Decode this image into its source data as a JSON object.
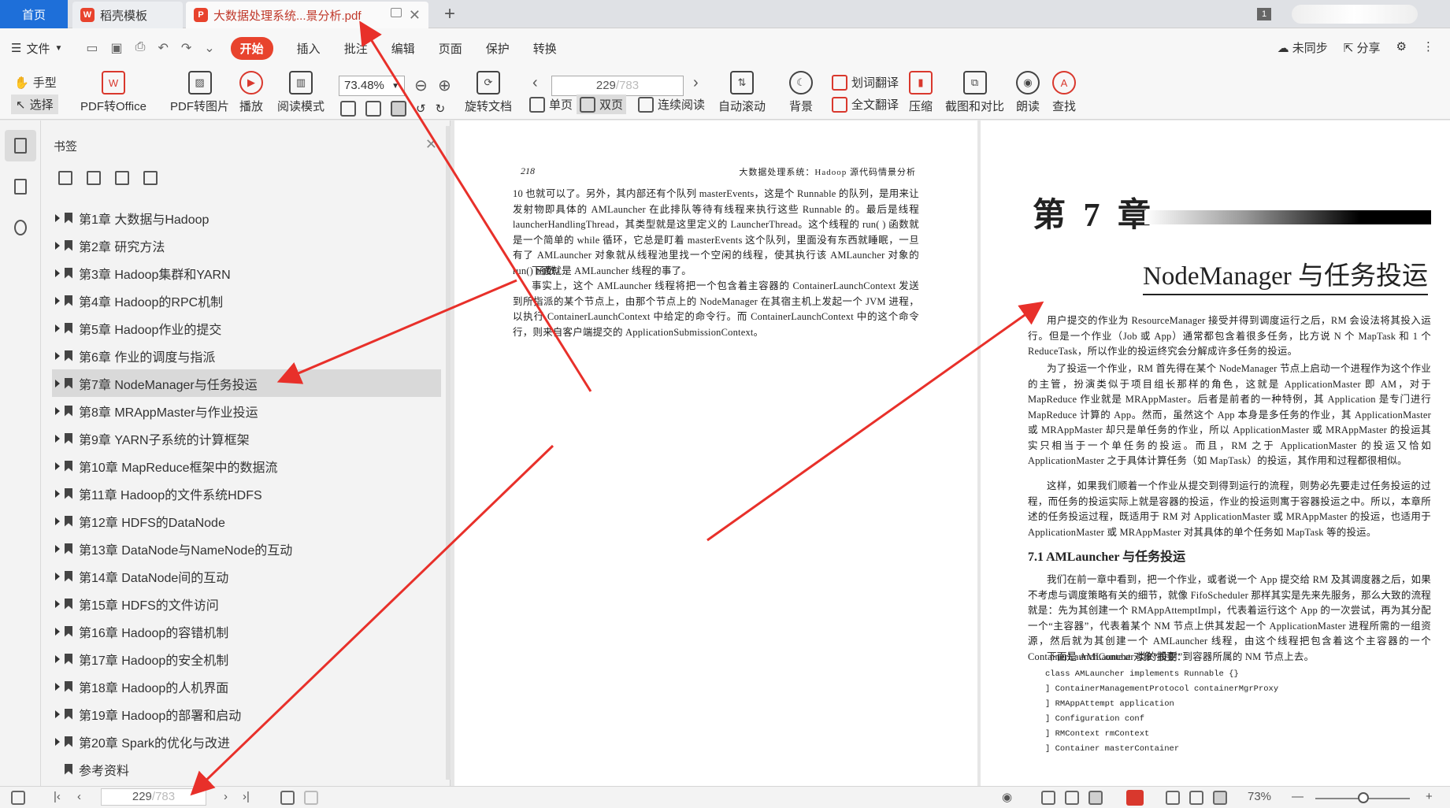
{
  "tabs": {
    "home": "首页",
    "template": "稻壳模板",
    "document": "大数据处理系统...景分析.pdf",
    "counter": "1"
  },
  "menu": {
    "file": "文件",
    "items": [
      "开始",
      "插入",
      "批注",
      "编辑",
      "页面",
      "保护",
      "转换"
    ],
    "sync": "未同步",
    "share": "分享"
  },
  "toolbar": {
    "hand": "手型",
    "select": "选择",
    "pdf_to_office": "PDF转Office",
    "pdf_to_image": "PDF转图片",
    "play": "播放",
    "read_mode": "阅读模式",
    "zoom": "73.48%",
    "rotate": "旋转文档",
    "page_current": "229",
    "page_total": "/783",
    "single": "单页",
    "double": "双页",
    "continuous": "连续阅读",
    "auto_scroll": "自动滚动",
    "background": "背景",
    "word_translate": "划词翻译",
    "full_translate": "全文翻译",
    "compress": "压缩",
    "screenshot": "截图和对比",
    "read_aloud": "朗读",
    "find": "查找"
  },
  "bookmarks": {
    "title": "书签",
    "items": [
      "第1章  大数据与Hadoop",
      "第2章  研究方法",
      "第3章  Hadoop集群和YARN",
      "第4章  Hadoop的RPC机制",
      "第5章  Hadoop作业的提交",
      "第6章  作业的调度与指派",
      "第7章  NodeManager与任务投运",
      "第8章  MRAppMaster与作业投运",
      "第9章  YARN子系统的计算框架",
      "第10章  MapReduce框架中的数据流",
      "第11章  Hadoop的文件系统HDFS",
      "第12章  HDFS的DataNode",
      "第13章  DataNode与NameNode的互动",
      "第14章  DataNode间的互动",
      "第15章  HDFS的文件访问",
      "第16章  Hadoop的容错机制",
      "第17章  Hadoop的安全机制",
      "第18章  Hadoop的人机界面",
      "第19章  Hadoop的部署和启动",
      "第20章  Spark的优化与改进",
      "参考资料"
    ]
  },
  "left_page": {
    "page_number": "218",
    "header": "大数据处理系统：Hadoop 源代码情景分析",
    "p1": "10 也就可以了。另外，其内部还有个队列 masterEvents，这是个 Runnable 的队列，是用来让发射物即具体的 AMLauncher 在此排队等待有线程来执行这些 Runnable 的。最后是线程 launcherHandlingThread，其类型就是这里定义的 LauncherThread。这个线程的 run( ) 函数就是一个简单的 while 循环，它总是盯着 masterEvents 这个队列，里面没有东西就睡眠，一旦有了 AMLauncher 对象就从线程池里找一个空闲的线程，使其执行该 AMLauncher 对象的 run() 函数。",
    "p2": "下面就是 AMLauncher 线程的事了。",
    "p3": "事实上，这个 AMLauncher 线程将把一个包含着主容器的 ContainerLaunchContext 发送到所指派的某个节点上，由那个节点上的 NodeManager 在其宿主机上发起一个 JVM 进程，以执行 ContainerLaunchContext 中给定的命令行。而 ContainerLaunchContext 中的这个命令行，则来自客户端提交的 ApplicationSubmissionContext。"
  },
  "right_page": {
    "chapter": "第 7 章",
    "chapter_title": "NodeManager 与任务投运",
    "p1": "用户提交的作业为 ResourceManager 接受并得到调度运行之后，RM 会设法将其投入运行。但是一个作业（Job 或 App）通常都包含着很多任务，比方说 N 个 MapTask 和 1 个 ReduceTask，所以作业的投运终究会分解成许多任务的投运。",
    "p2": "为了投运一个作业，RM 首先得在某个 NodeManager 节点上启动一个进程作为这个作业的主管，扮演类似于项目组长那样的角色，这就是 ApplicationMaster 即 AM，对于 MapReduce 作业就是 MRAppMaster。后者是前者的一种特例，其 Application 是专门进行 MapReduce 计算的 App。然而，虽然这个 App 本身是多任务的作业，其 ApplicationMaster 或 MRAppMaster 却只是单任务的作业，所以 ApplicationMaster 或 MRAppMaster 的投运其实只相当于一个单任务的投运。而且，RM 之于 ApplicationMaster 的投运又恰如 ApplicationMaster 之于具体计算任务（如 MapTask）的投运，其作用和过程都很相似。",
    "p3": "这样，如果我们顺着一个作业从提交到得到运行的流程，则势必先要走过任务投运的过程，而任务的投运实际上就是容器的投运，作业的投运则寓于容器投运之中。所以，本章所述的任务投运过程，既适用于 RM 对 ApplicationMaster 或 MRAppMaster 的投运，也适用于 ApplicationMaster 或 MRAppMaster 对其具体的单个任务如 MapTask 等的投运。",
    "section": "7.1    AMLauncher 与任务投运",
    "p4": "我们在前一章中看到，把一个作业，或者说一个 App 提交给 RM 及其调度器之后，如果不考虑与调度策略有关的细节，就像 FifoScheduler 那样其实是先来先服务，那么大致的流程就是：先为其创建一个 RMAppAttemptImpl，代表着运行这个 App 的一次尝试，再为其分配一个“主容器”，代表着某个 NM 节点上供其发起一个 ApplicationMaster 进程所需的一组资源，然后就为其创建一个 AMLauncher 线程，由这个线程把包含着这个主容器的一个 ContainerLaunchContext 对象“投射”到容器所属的 NM 节点上去。",
    "p5": "下面是 AMLauncher 类的摘要：",
    "code": [
      "class AMLauncher implements Runnable {}",
      "] ContainerManagementProtocol containerMgrProxy",
      "] RMAppAttempt application",
      "] Configuration conf",
      "] RMContext rmContext",
      "] Container masterContainer"
    ]
  },
  "statusbar": {
    "page_current": "229",
    "page_total": "/783",
    "zoom": "73%"
  },
  "colors": {
    "accent_red": "#e8432d",
    "home_tab_blue": "#1e6fd9",
    "annotation_red": "#e8302a"
  }
}
